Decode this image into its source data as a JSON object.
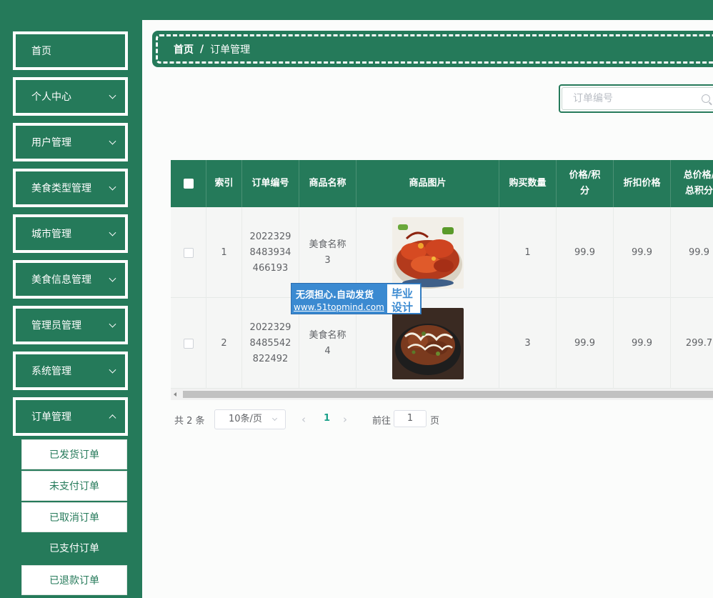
{
  "breadcrumb": {
    "home": "首页",
    "separator": "/",
    "current": "订单管理"
  },
  "search": {
    "placeholder": "订单编号"
  },
  "sidebar": {
    "items": [
      {
        "label": "首页"
      },
      {
        "label": "个人中心"
      },
      {
        "label": "用户管理"
      },
      {
        "label": "美食类型管理"
      },
      {
        "label": "城市管理"
      },
      {
        "label": "美食信息管理"
      },
      {
        "label": "管理员管理"
      },
      {
        "label": "系统管理"
      },
      {
        "label": "订单管理"
      }
    ],
    "subitems": [
      {
        "label": "已发货订单"
      },
      {
        "label": "未支付订单"
      },
      {
        "label": "已取消订单"
      },
      {
        "label": "已支付订单",
        "active": true
      },
      {
        "label": "已退款订单"
      }
    ]
  },
  "table": {
    "headers": [
      "索引",
      "订单编号",
      "商品名称",
      "商品图片",
      "购买数量",
      "价格/积分",
      "折扣价格",
      "总价格/总积分"
    ],
    "rows": [
      {
        "index": "1",
        "order_no": "20223298483934466193",
        "product": "美食名称3",
        "image": "crayfish-dish",
        "qty": "1",
        "price": "99.9",
        "discount": "99.9",
        "total": "99.9"
      },
      {
        "index": "2",
        "order_no": "20223298485542822492",
        "product": "美食名称4",
        "image": "grilled-meat-dish",
        "qty": "3",
        "price": "99.9",
        "discount": "99.9",
        "total": "299.7"
      }
    ]
  },
  "pagination": {
    "total": "共 2 条",
    "page_size": "10条/页",
    "current_page": "1",
    "goto_label": "前往",
    "goto_value": "1",
    "page_unit": "页"
  },
  "watermark": {
    "line1": "无须担心.自动发货",
    "line2": "www.51topmind.com",
    "badge_line1": "毕业",
    "badge_line2": "设计"
  },
  "colors": {
    "primary": "#257a5a",
    "accent": "#1aa089",
    "watermark": "#3b8ad1"
  }
}
